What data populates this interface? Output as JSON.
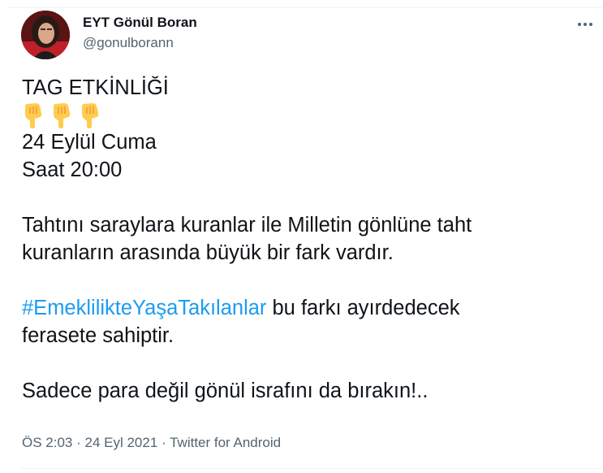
{
  "tweet": {
    "author": {
      "display_name": "EYT Gönül Boran",
      "handle": "@gonulborann"
    },
    "more_icon": "more-horizontal-icon",
    "text": {
      "line1": "TAG ETKİNLİĞİ",
      "emoji_icon": "backhand-index-pointing-down-emoji",
      "line3": "24 Eylül Cuma",
      "line4": "Saat 20:00",
      "para2_line1": "Tahtını saraylara kuranlar ile Milletin gönlüne taht",
      "para2_line2": "kuranların arasında büyük bir fark vardır.",
      "hashtag": "#EmeklilikteYaşaTakılanlar",
      "para3_line1_rest": " bu farkı ayırdedecek",
      "para3_line2": "ferasete sahiptir.",
      "para4": "Sadece para değil gönül israfını da bırakın!.."
    },
    "meta": {
      "time": "ÖS 2:03",
      "separator": " · ",
      "date": "24 Eyl 2021",
      "source": "Twitter for Android"
    },
    "colors": {
      "text": "#0f1419",
      "secondary": "#536471",
      "link": "#1d9bf0",
      "emoji": "#ffcc4d"
    }
  }
}
